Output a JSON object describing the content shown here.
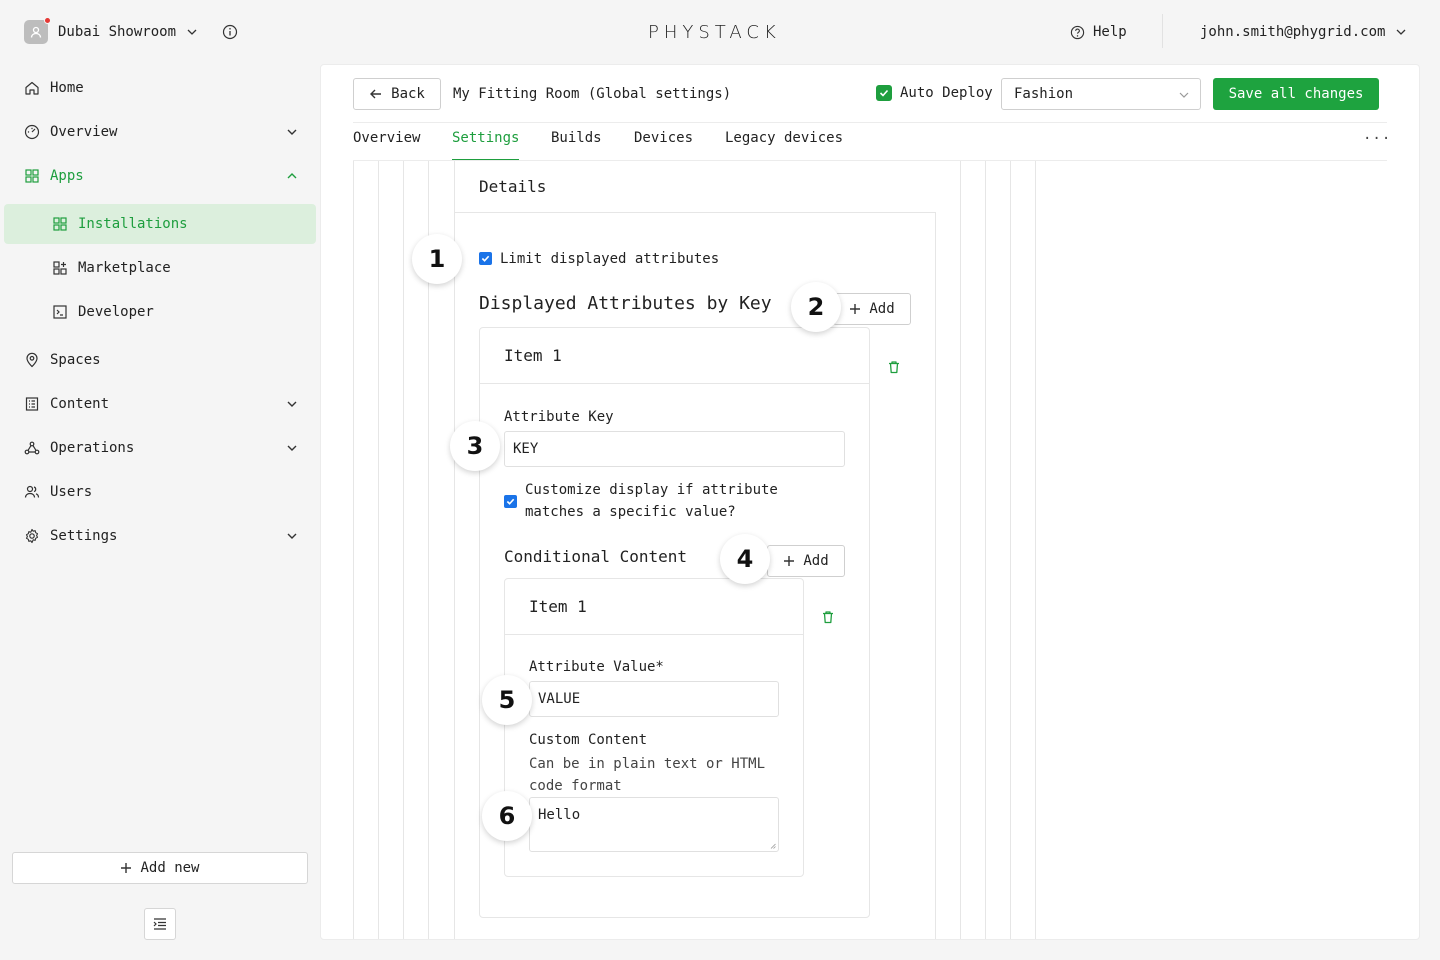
{
  "topbar": {
    "org_name": "Dubai Showroom",
    "logo": "PHYSTACK",
    "help_label": "Help",
    "user_email": "john.smith@phygrid.com"
  },
  "sidebar": {
    "items": [
      {
        "label": "Home",
        "icon": "home-icon"
      },
      {
        "label": "Overview",
        "icon": "dashboard-icon"
      },
      {
        "label": "Apps",
        "icon": "grid-icon"
      },
      {
        "label": "Installations",
        "icon": "grid-icon"
      },
      {
        "label": "Marketplace",
        "icon": "apps-plus-icon"
      },
      {
        "label": "Developer",
        "icon": "terminal-icon"
      },
      {
        "label": "Spaces",
        "icon": "location-pin-icon"
      },
      {
        "label": "Content",
        "icon": "document-icon"
      },
      {
        "label": "Operations",
        "icon": "network-icon"
      },
      {
        "label": "Users",
        "icon": "users-icon"
      },
      {
        "label": "Settings",
        "icon": "gear-icon"
      }
    ],
    "add_new_label": "Add new"
  },
  "header": {
    "back_label": "Back",
    "title": "My Fitting Room (Global settings)",
    "auto_deploy_label": "Auto Deploy",
    "auto_deploy_checked": true,
    "select_value": "Fashion",
    "save_label": "Save all changes"
  },
  "tabs": [
    "Overview",
    "Settings",
    "Builds",
    "Devices",
    "Legacy devices"
  ],
  "active_tab": "Settings",
  "form": {
    "details_title": "Details",
    "limit_label": "Limit displayed attributes",
    "limit_checked": true,
    "attributes_title": "Displayed Attributes by Key",
    "add_label": "Add",
    "item_title": "Item 1",
    "attribute_key_label": "Attribute Key",
    "attribute_key_value": "KEY",
    "customize_label": "Customize display if attribute matches a specific value?",
    "customize_checked": true,
    "conditional_title": "Conditional Content",
    "add_label_2": "Add",
    "sub_item_title": "Item 1",
    "attribute_value_label": "Attribute Value*",
    "attribute_value_value": "VALUE",
    "custom_content_label": "Custom Content",
    "custom_content_help": "Can be in plain text or HTML code format",
    "custom_content_value": "Hello"
  },
  "callouts": [
    "1",
    "2",
    "3",
    "4",
    "5",
    "6"
  ],
  "colors": {
    "accent": "#1e9e3e",
    "active_bg": "#dcefdd",
    "checkbox_blue": "#1a73e8",
    "notification": "#e53935"
  }
}
